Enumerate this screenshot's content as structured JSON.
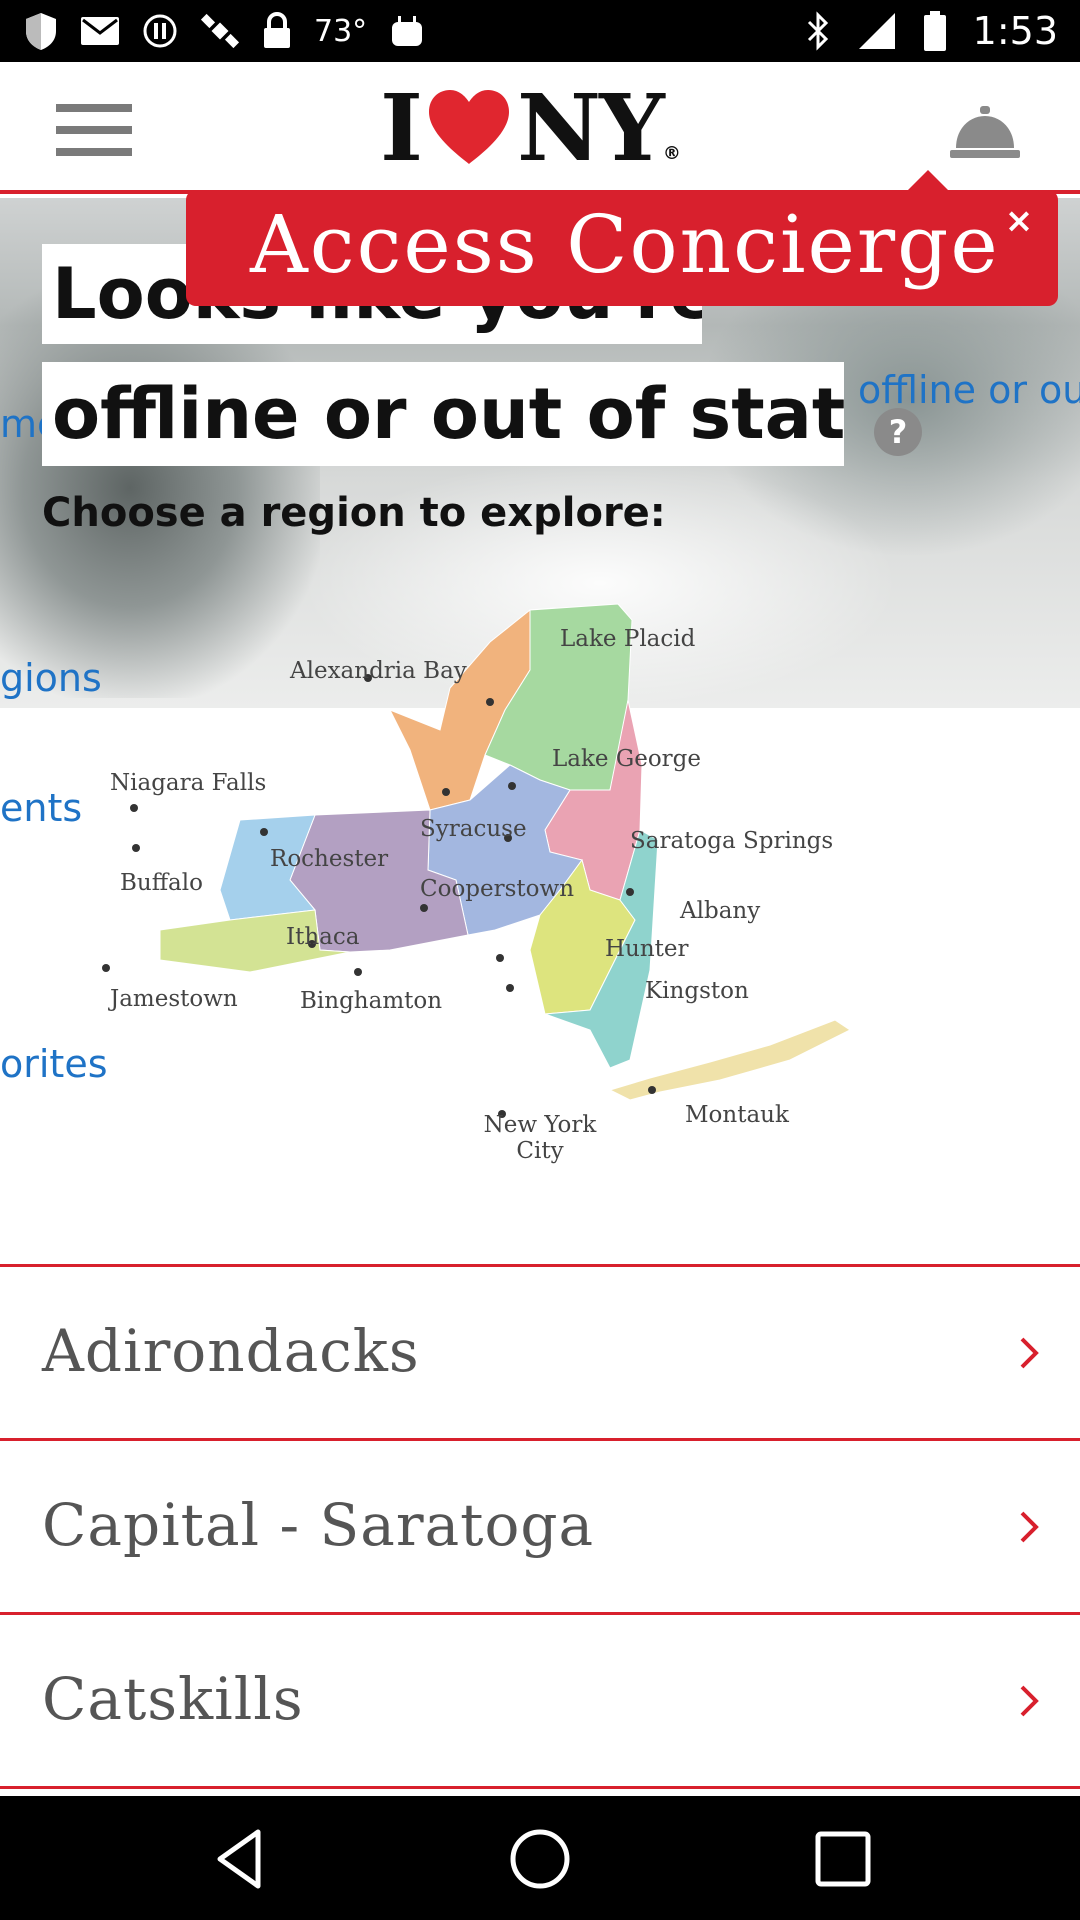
{
  "status_bar": {
    "temperature": "73°",
    "time": "1:53"
  },
  "header": {
    "logo_left": "I",
    "logo_right": "NY",
    "logo_mark": "®"
  },
  "concierge_popup": {
    "label": "Access Concierge",
    "close": "×"
  },
  "background_menu": {
    "items": [
      "offline or ou",
      "me",
      "gions",
      "ents",
      "orites"
    ]
  },
  "hero": {
    "headline_line1": "Looks like you're",
    "headline_line2": "offline or out of state",
    "help": "?",
    "prompt": "Choose a region to explore:"
  },
  "map": {
    "cities": [
      {
        "name": "Lake Placid"
      },
      {
        "name": "Alexandria Bay"
      },
      {
        "name": "Lake George"
      },
      {
        "name": "Niagara Falls"
      },
      {
        "name": "Syracuse"
      },
      {
        "name": "Saratoga Springs"
      },
      {
        "name": "Rochester"
      },
      {
        "name": "Buffalo"
      },
      {
        "name": "Cooperstown"
      },
      {
        "name": "Albany"
      },
      {
        "name": "Ithaca"
      },
      {
        "name": "Hunter"
      },
      {
        "name": "Kingston"
      },
      {
        "name": "Jamestown"
      },
      {
        "name": "Binghamton"
      },
      {
        "name": "Montauk"
      },
      {
        "name": "New York City"
      }
    ],
    "region_colors": {
      "thousand_islands": "#f1b37d",
      "adirondacks": "#a6d9a0",
      "capital_saratoga": "#eaa3b3",
      "central": "#a3b7e0",
      "finger_lakes": "#b3a0c2",
      "greater_niagara": "#a5d0ec",
      "chautauqua": "#d3e394",
      "catskills": "#dde47e",
      "hudson_valley": "#8fd3cd",
      "long_island": "#f0e2aa"
    }
  },
  "regions": [
    {
      "name": "Adirondacks"
    },
    {
      "name": "Capital - Saratoga"
    },
    {
      "name": "Catskills"
    }
  ],
  "colors": {
    "brand_red": "#d8202d",
    "link_blue": "#1f73c6"
  }
}
